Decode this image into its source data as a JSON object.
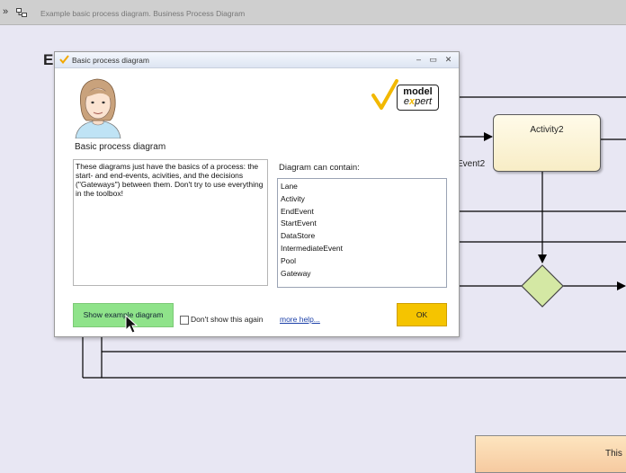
{
  "topbar": {
    "breadcrumb": "Example basic process diagram.  Business Process Diagram"
  },
  "canvas": {
    "diagram_title_fragment": "E:",
    "activity_label": "Activity2",
    "event_label_fragment": "Event2",
    "bottom_box_fragment": "This"
  },
  "dialog": {
    "title": "Basic process diagram",
    "heading": "Basic process diagram",
    "description": "These diagrams just have the basics of a process: the start- and end-events, acivities, and the decisions (\"Gateways\") between them. Don't try to use everything in the toolbox!",
    "contain_label": "Diagram can contain:",
    "contain_items": [
      "Lane",
      "Activity",
      "EndEvent",
      "StartEvent",
      "DataStore",
      "IntermediateEvent",
      "Pool",
      "Gateway"
    ],
    "show_example_label": "Show example diagram",
    "dont_show_label": "Don't show this again",
    "dont_show_checked": false,
    "more_help_label": "more help...",
    "ok_label": "OK",
    "logo_line1": "model",
    "logo_line2_prefix": "e",
    "logo_line2_accent": "x",
    "logo_line2_suffix": "pert"
  },
  "colors": {
    "canvas_bg": "#e8e7f3",
    "activity_fill": "#faf0c8",
    "gateway_fill": "#d4e8a4",
    "show_button": "#8fe38a",
    "ok_button": "#f5c400",
    "logo_accent": "#f2b800"
  }
}
